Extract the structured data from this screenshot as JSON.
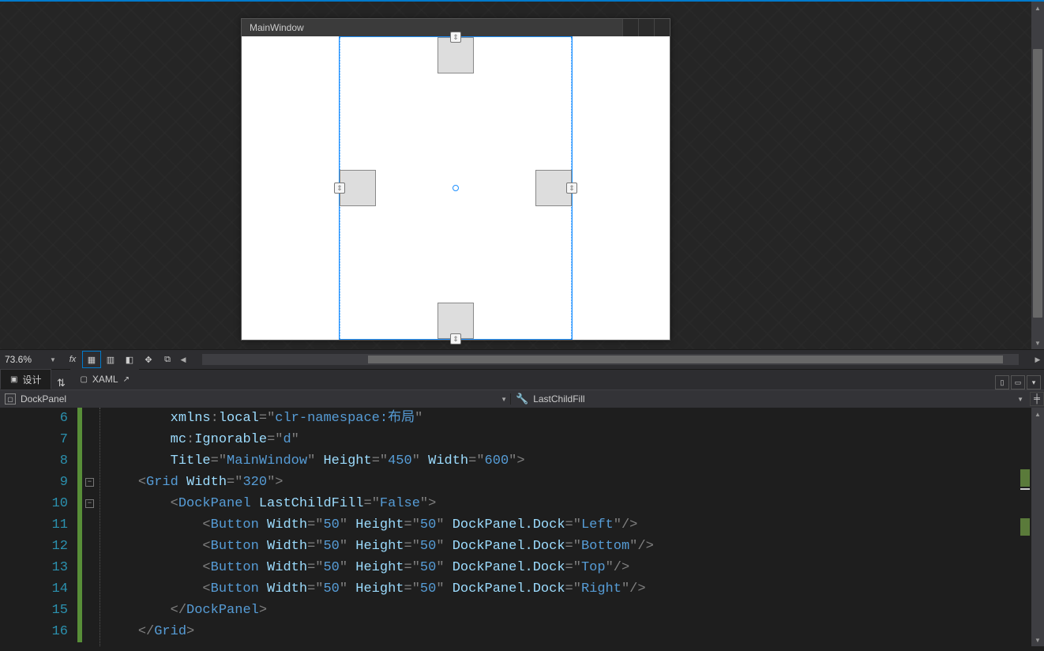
{
  "designer": {
    "window_title": "MainWindow"
  },
  "toolbar": {
    "zoom": "73.6%"
  },
  "tabs": {
    "design": "设计",
    "xaml": "XAML"
  },
  "pathbar": {
    "element": "DockPanel",
    "property": "LastChildFill"
  },
  "code": {
    "lines": [
      {
        "n": 6,
        "html": "        <span class='c-attr'>xmlns</span><span class='c-punct'>:</span><span class='c-attr'>local</span><span class='c-punct'>=</span><span class='c-punct'>\"</span><span class='c-tag'>clr-namespace:布局</span><span class='c-punct'>\"</span>"
      },
      {
        "n": 7,
        "html": "        <span class='c-attr'>mc</span><span class='c-punct'>:</span><span class='c-attr'>Ignorable</span><span class='c-punct'>=</span><span class='c-punct'>\"</span><span class='c-tag'>d</span><span class='c-punct'>\"</span>"
      },
      {
        "n": 8,
        "html": "        <span class='c-attr'>Title</span><span class='c-punct'>=</span><span class='c-punct'>\"</span><span class='c-tag'>MainWindow</span><span class='c-punct'>\"</span> <span class='c-attr'>Height</span><span class='c-punct'>=</span><span class='c-punct'>\"</span><span class='c-tag'>450</span><span class='c-punct'>\"</span> <span class='c-attr'>Width</span><span class='c-punct'>=</span><span class='c-punct'>\"</span><span class='c-tag'>600</span><span class='c-punct'>\"</span><span class='c-punct'>&gt;</span>"
      },
      {
        "n": 9,
        "html": "    <span class='c-punct'>&lt;</span><span class='c-tag'>Grid</span> <span class='c-attr'>Width</span><span class='c-punct'>=</span><span class='c-punct'>\"</span><span class='c-tag'>320</span><span class='c-punct'>\"</span><span class='c-punct'>&gt;</span>"
      },
      {
        "n": 10,
        "html": "        <span class='c-punct'>&lt;</span><span class='c-tag'>DockPanel</span> <span class='c-attr'>LastChildFill</span><span class='c-punct'>=</span><span class='c-punct'>\"</span><span class='c-tag'>False</span><span class='c-punct'>\"</span><span class='c-punct'>&gt;</span>"
      },
      {
        "n": 11,
        "html": "            <span class='c-punct'>&lt;</span><span class='c-tag'>Button</span> <span class='c-attr'>Width</span><span class='c-punct'>=</span><span class='c-punct'>\"</span><span class='c-tag'>50</span><span class='c-punct'>\"</span> <span class='c-attr'>Height</span><span class='c-punct'>=</span><span class='c-punct'>\"</span><span class='c-tag'>50</span><span class='c-punct'>\"</span> <span class='c-attr'>DockPanel.Dock</span><span class='c-punct'>=</span><span class='c-punct'>\"</span><span class='c-tag'>Left</span><span class='c-punct'>\"</span><span class='c-punct'>/&gt;</span>"
      },
      {
        "n": 12,
        "html": "            <span class='c-punct'>&lt;</span><span class='c-tag'>Button</span> <span class='c-attr'>Width</span><span class='c-punct'>=</span><span class='c-punct'>\"</span><span class='c-tag'>50</span><span class='c-punct'>\"</span> <span class='c-attr'>Height</span><span class='c-punct'>=</span><span class='c-punct'>\"</span><span class='c-tag'>50</span><span class='c-punct'>\"</span> <span class='c-attr'>DockPanel.Dock</span><span class='c-punct'>=</span><span class='c-punct'>\"</span><span class='c-tag'>Bottom</span><span class='c-punct'>\"</span><span class='c-punct'>/&gt;</span>"
      },
      {
        "n": 13,
        "html": "            <span class='c-punct'>&lt;</span><span class='c-tag'>Button</span> <span class='c-attr'>Width</span><span class='c-punct'>=</span><span class='c-punct'>\"</span><span class='c-tag'>50</span><span class='c-punct'>\"</span> <span class='c-attr'>Height</span><span class='c-punct'>=</span><span class='c-punct'>\"</span><span class='c-tag'>50</span><span class='c-punct'>\"</span> <span class='c-attr'>DockPanel.Dock</span><span class='c-punct'>=</span><span class='c-punct'>\"</span><span class='c-tag'>Top</span><span class='c-punct'>\"</span><span class='c-punct'>/&gt;</span>"
      },
      {
        "n": 14,
        "html": "            <span class='c-punct'>&lt;</span><span class='c-tag'>Button</span> <span class='c-attr'>Width</span><span class='c-punct'>=</span><span class='c-punct'>\"</span><span class='c-tag'>50</span><span class='c-punct'>\"</span> <span class='c-attr'>Height</span><span class='c-punct'>=</span><span class='c-punct'>\"</span><span class='c-tag'>50</span><span class='c-punct'>\"</span> <span class='c-attr'>DockPanel.Dock</span><span class='c-punct'>=</span><span class='c-punct'>\"</span><span class='c-tag'>Right</span><span class='c-punct'>\"</span><span class='c-punct'>/&gt;</span>"
      },
      {
        "n": 15,
        "html": "        <span class='c-punct'>&lt;/</span><span class='c-tag'>DockPanel</span><span class='c-punct'>&gt;</span>"
      },
      {
        "n": 16,
        "html": "    <span class='c-punct'>&lt;/</span><span class='c-tag'>Grid</span><span class='c-punct'>&gt;</span>"
      }
    ]
  }
}
